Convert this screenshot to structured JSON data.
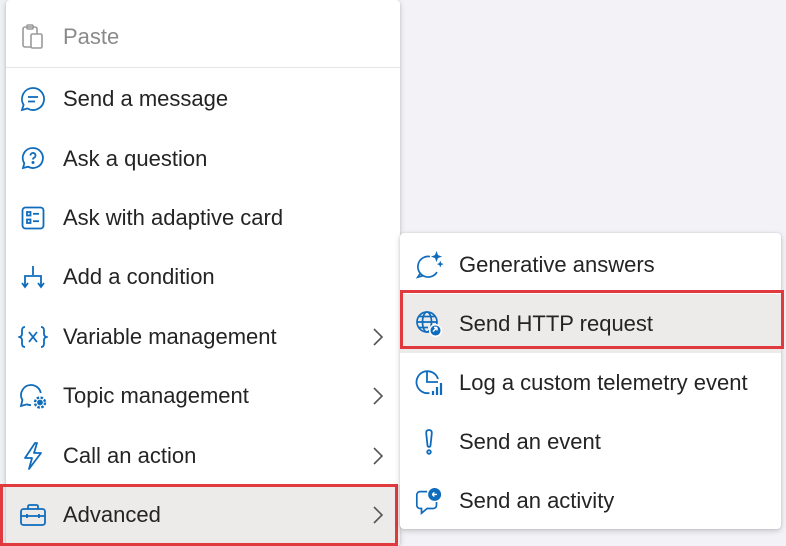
{
  "main_menu": {
    "paste_label": "Paste",
    "items": [
      {
        "label": "Send a message",
        "icon": "chat-bubble-icon"
      },
      {
        "label": "Ask a question",
        "icon": "question-bubble-icon"
      },
      {
        "label": "Ask with adaptive card",
        "icon": "adaptive-card-icon"
      },
      {
        "label": "Add a condition",
        "icon": "branch-icon"
      },
      {
        "label": "Variable management",
        "icon": "variable-icon"
      },
      {
        "label": "Topic management",
        "icon": "topic-gear-icon"
      },
      {
        "label": "Call an action",
        "icon": "lightning-icon"
      },
      {
        "label": "Advanced",
        "icon": "toolbox-icon"
      }
    ]
  },
  "sub_menu": {
    "items": [
      {
        "label": "Generative answers",
        "icon": "sparkle-chat-icon"
      },
      {
        "label": "Send HTTP request",
        "icon": "globe-arrow-icon"
      },
      {
        "label": "Log a custom telemetry event",
        "icon": "telemetry-chart-icon"
      },
      {
        "label": "Send an event",
        "icon": "exclamation-icon"
      },
      {
        "label": "Send an activity",
        "icon": "activity-chat-icon"
      }
    ]
  },
  "colors": {
    "accent": "#0f6cbd",
    "highlight_border": "#e0393e",
    "selected_bg": "#ecebea"
  }
}
